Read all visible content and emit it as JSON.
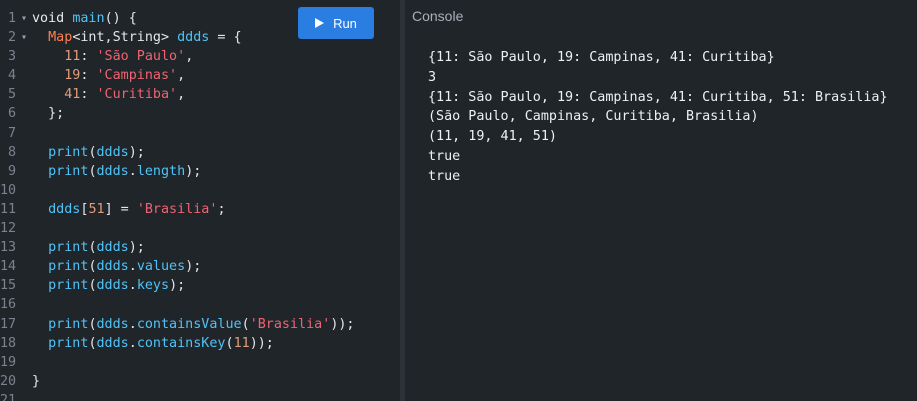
{
  "editor": {
    "run_label": "Run",
    "lines": [
      {
        "n": "1",
        "fold": "▾",
        "segs": [
          [
            "kw",
            "void "
          ],
          [
            "fn",
            "main"
          ],
          [
            "pl",
            "() {"
          ]
        ]
      },
      {
        "n": "2",
        "fold": "▾",
        "segs": [
          [
            "pl",
            "  "
          ],
          [
            "ty",
            "Map"
          ],
          [
            "pl",
            "<int,String> "
          ],
          [
            "fn",
            "ddds"
          ],
          [
            "pl",
            " = {"
          ]
        ]
      },
      {
        "n": "3",
        "fold": "",
        "segs": [
          [
            "pl",
            "    "
          ],
          [
            "nm",
            "11"
          ],
          [
            "pl",
            ": "
          ],
          [
            "st",
            "'São Paulo'"
          ],
          [
            "pl",
            ","
          ]
        ]
      },
      {
        "n": "4",
        "fold": "",
        "segs": [
          [
            "pl",
            "    "
          ],
          [
            "nm",
            "19"
          ],
          [
            "pl",
            ": "
          ],
          [
            "st",
            "'Campinas'"
          ],
          [
            "pl",
            ","
          ]
        ]
      },
      {
        "n": "5",
        "fold": "",
        "segs": [
          [
            "pl",
            "    "
          ],
          [
            "nm",
            "41"
          ],
          [
            "pl",
            ": "
          ],
          [
            "st",
            "'Curitiba'"
          ],
          [
            "pl",
            ","
          ]
        ]
      },
      {
        "n": "6",
        "fold": "",
        "segs": [
          [
            "pl",
            "  };"
          ]
        ]
      },
      {
        "n": "7",
        "fold": "",
        "segs": []
      },
      {
        "n": "8",
        "fold": "",
        "segs": [
          [
            "pl",
            "  "
          ],
          [
            "fn",
            "print"
          ],
          [
            "pl",
            "("
          ],
          [
            "fn",
            "ddds"
          ],
          [
            "pl",
            ");"
          ]
        ]
      },
      {
        "n": "9",
        "fold": "",
        "segs": [
          [
            "pl",
            "  "
          ],
          [
            "fn",
            "print"
          ],
          [
            "pl",
            "("
          ],
          [
            "fn",
            "ddds"
          ],
          [
            "pl",
            "."
          ],
          [
            "fn",
            "length"
          ],
          [
            "pl",
            ");"
          ]
        ]
      },
      {
        "n": "10",
        "fold": "",
        "segs": []
      },
      {
        "n": "11",
        "fold": "",
        "segs": [
          [
            "pl",
            "  "
          ],
          [
            "fn",
            "ddds"
          ],
          [
            "pl",
            "["
          ],
          [
            "nm",
            "51"
          ],
          [
            "pl",
            "] = "
          ],
          [
            "st",
            "'Brasilia'"
          ],
          [
            "pl",
            ";"
          ]
        ]
      },
      {
        "n": "12",
        "fold": "",
        "segs": []
      },
      {
        "n": "13",
        "fold": "",
        "segs": [
          [
            "pl",
            "  "
          ],
          [
            "fn",
            "print"
          ],
          [
            "pl",
            "("
          ],
          [
            "fn",
            "ddds"
          ],
          [
            "pl",
            ");"
          ]
        ]
      },
      {
        "n": "14",
        "fold": "",
        "segs": [
          [
            "pl",
            "  "
          ],
          [
            "fn",
            "print"
          ],
          [
            "pl",
            "("
          ],
          [
            "fn",
            "ddds"
          ],
          [
            "pl",
            "."
          ],
          [
            "fn",
            "values"
          ],
          [
            "pl",
            ");"
          ]
        ]
      },
      {
        "n": "15",
        "fold": "",
        "segs": [
          [
            "pl",
            "  "
          ],
          [
            "fn",
            "print"
          ],
          [
            "pl",
            "("
          ],
          [
            "fn",
            "ddds"
          ],
          [
            "pl",
            "."
          ],
          [
            "fn",
            "keys"
          ],
          [
            "pl",
            ");"
          ]
        ]
      },
      {
        "n": "16",
        "fold": "",
        "segs": []
      },
      {
        "n": "17",
        "fold": "",
        "segs": [
          [
            "pl",
            "  "
          ],
          [
            "fn",
            "print"
          ],
          [
            "pl",
            "("
          ],
          [
            "fn",
            "ddds"
          ],
          [
            "pl",
            "."
          ],
          [
            "fn",
            "containsValue"
          ],
          [
            "pl",
            "("
          ],
          [
            "st",
            "'Brasilia'"
          ],
          [
            "pl",
            "));"
          ]
        ]
      },
      {
        "n": "18",
        "fold": "",
        "segs": [
          [
            "pl",
            "  "
          ],
          [
            "fn",
            "print"
          ],
          [
            "pl",
            "("
          ],
          [
            "fn",
            "ddds"
          ],
          [
            "pl",
            "."
          ],
          [
            "fn",
            "containsKey"
          ],
          [
            "pl",
            "("
          ],
          [
            "nm",
            "11"
          ],
          [
            "pl",
            "));"
          ]
        ]
      },
      {
        "n": "19",
        "fold": "",
        "segs": []
      },
      {
        "n": "20",
        "fold": "",
        "segs": [
          [
            "pl",
            "}"
          ]
        ]
      },
      {
        "n": "21",
        "fold": "",
        "segs": []
      }
    ]
  },
  "console": {
    "title": "Console",
    "output": [
      "{11: São Paulo, 19: Campinas, 41: Curitiba}",
      "3",
      "{11: São Paulo, 19: Campinas, 41: Curitiba, 51: Brasilia}",
      "(São Paulo, Campinas, Curitiba, Brasilia)",
      "(11, 19, 41, 51)",
      "true",
      "true"
    ]
  },
  "colors": {
    "background": "#20252a",
    "run_button": "#2a7de1",
    "identifier": "#4fc3f7",
    "type": "#ff7f50",
    "string": "#f06370",
    "number": "#e39b7b"
  },
  "icons": {
    "run": "play-icon",
    "fold": "fold-arrow-icon"
  }
}
